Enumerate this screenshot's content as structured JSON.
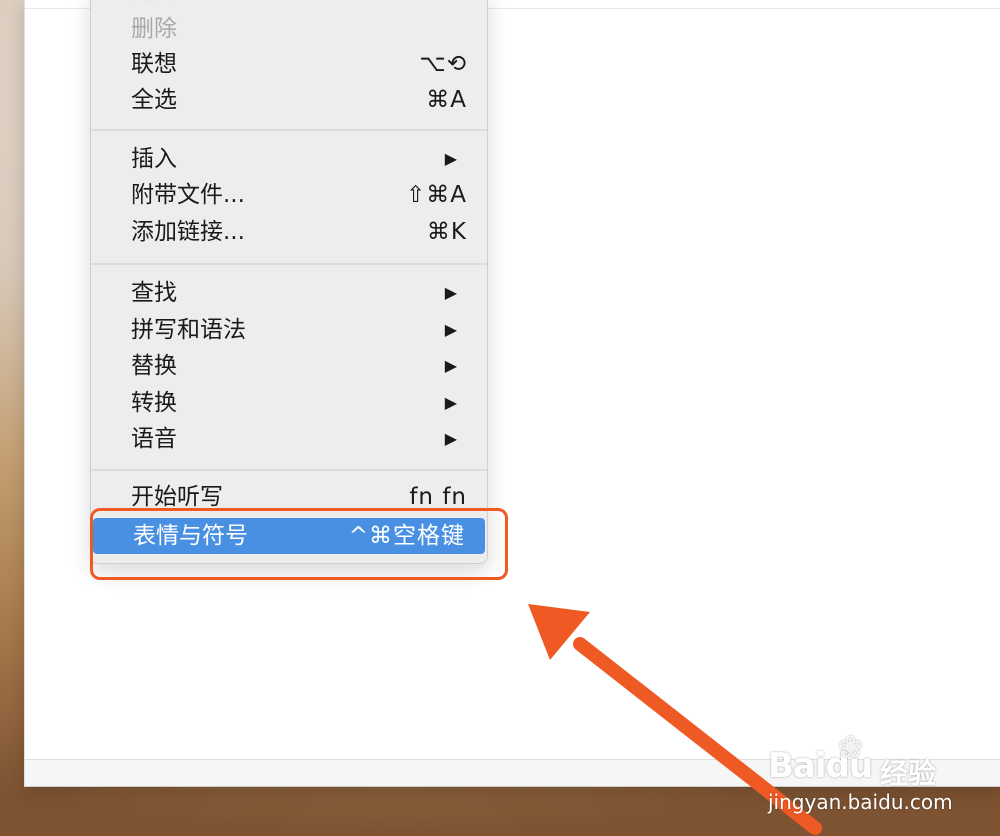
{
  "menu": {
    "clipped_top_label": "拷贝",
    "items": [
      {
        "label": "删除",
        "disabled": true
      },
      {
        "label": "联想",
        "shortcut": "⌥⟲"
      },
      {
        "label": "全选",
        "shortcut": "⌘A"
      },
      {
        "label": "插入",
        "submenu": true,
        "arrow": "▶"
      },
      {
        "label": "附带文件...",
        "shortcut": "⇧⌘A"
      },
      {
        "label": "添加链接...",
        "shortcut": "⌘K"
      },
      {
        "label": "查找",
        "submenu": true,
        "arrow": "▶"
      },
      {
        "label": "拼写和语法",
        "submenu": true,
        "arrow": "▶"
      },
      {
        "label": "替换",
        "submenu": true,
        "arrow": "▶"
      },
      {
        "label": "转换",
        "submenu": true,
        "arrow": "▶"
      },
      {
        "label": "语音",
        "submenu": true,
        "arrow": "▶"
      },
      {
        "label": "开始听写",
        "shortcut": "fn fn"
      },
      {
        "label": "表情与符号",
        "shortcut": "^⌘空格键",
        "highlighted": true
      }
    ]
  },
  "watermark": {
    "logo": "Bai",
    "logo_tail": "du",
    "brand": "经验",
    "url": "jingyan.baidu.com"
  },
  "colors": {
    "highlight": "#4a90e2",
    "annotation": "#ef5a24"
  },
  "icons": {
    "arrow": "annotation-arrow-icon",
    "paw": "baidu-paw-icon"
  }
}
